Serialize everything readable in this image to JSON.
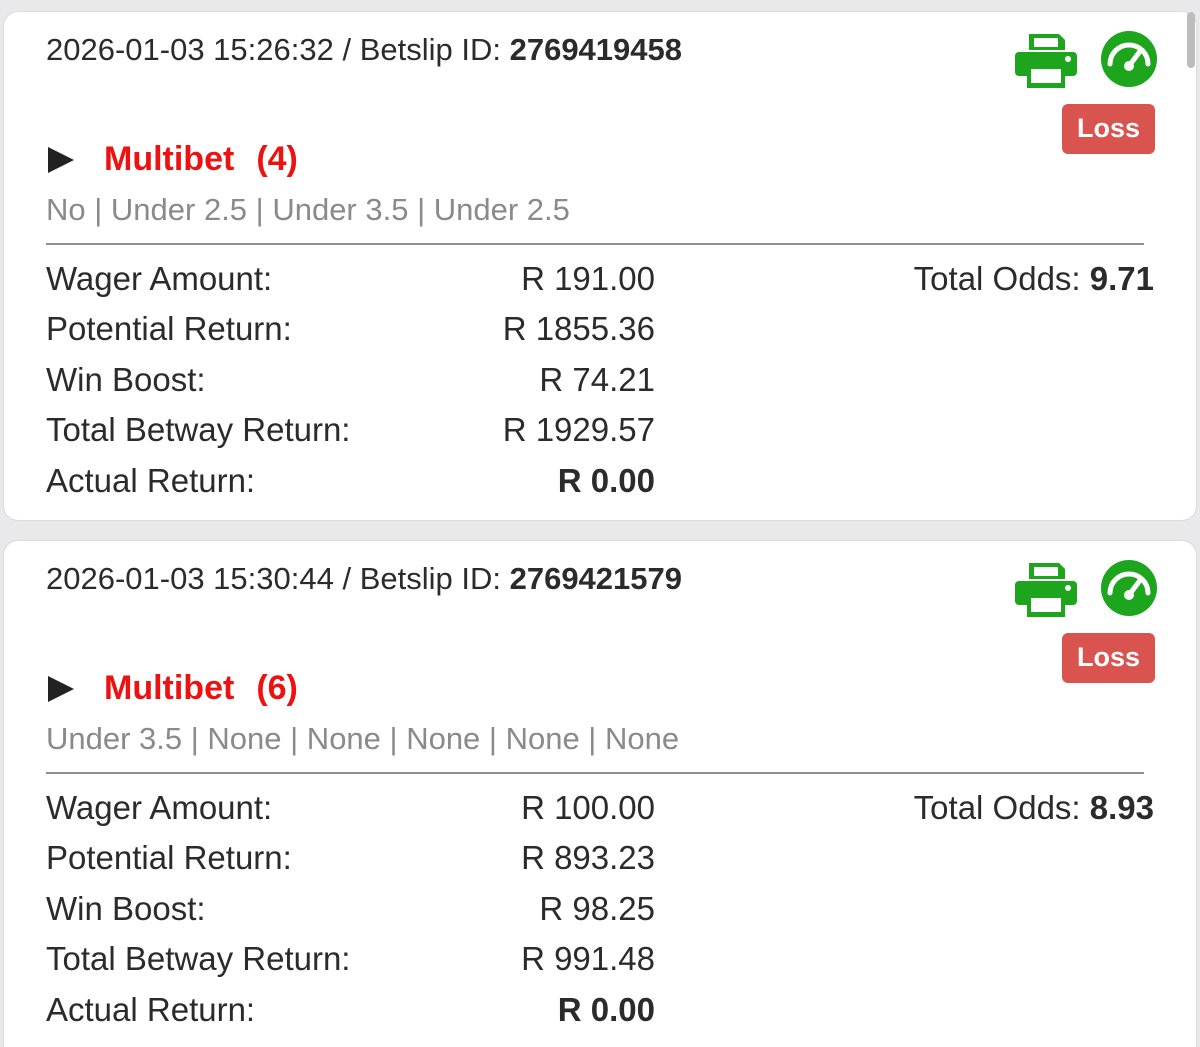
{
  "colors": {
    "loss_badge": "#d9534f",
    "bet_type": "#ee1111",
    "icon_green": "#1ea51e",
    "selection_text": "#8a8a8a"
  },
  "icons": {
    "print": "printer-icon",
    "gauge": "speedometer-icon",
    "expand": "play-triangle-icon"
  },
  "betslips": [
    {
      "datetime": "2026-01-03 15:26:32",
      "separator": " / ",
      "id_label": "Betslip ID: ",
      "id": "2769419458",
      "status": "Loss",
      "bet_type": "Multibet",
      "leg_count": "(4)",
      "selections": "No | Under 2.5 | Under 3.5 | Under 2.5",
      "wager_label": "Wager Amount:",
      "wager": "R 191.00",
      "potential_label": "Potential Return:",
      "potential": "R 1855.36",
      "boost_label": "Win Boost:",
      "boost": "R 74.21",
      "total_return_label": "Total Betway Return:",
      "total_return": "R 1929.57",
      "actual_label": "Actual Return:",
      "actual": "R 0.00",
      "odds_label": "Total Odds: ",
      "odds": "9.71"
    },
    {
      "datetime": "2026-01-03 15:30:44",
      "separator": " / ",
      "id_label": "Betslip ID: ",
      "id": "2769421579",
      "status": "Loss",
      "bet_type": "Multibet",
      "leg_count": "(6)",
      "selections": "Under 3.5 | None | None | None | None | None",
      "wager_label": "Wager Amount:",
      "wager": "R 100.00",
      "potential_label": "Potential Return:",
      "potential": "R 893.23",
      "boost_label": "Win Boost:",
      "boost": "R 98.25",
      "total_return_label": "Total Betway Return:",
      "total_return": "R 991.48",
      "actual_label": "Actual Return:",
      "actual": "R 0.00",
      "odds_label": "Total Odds: ",
      "odds": "8.93"
    }
  ]
}
